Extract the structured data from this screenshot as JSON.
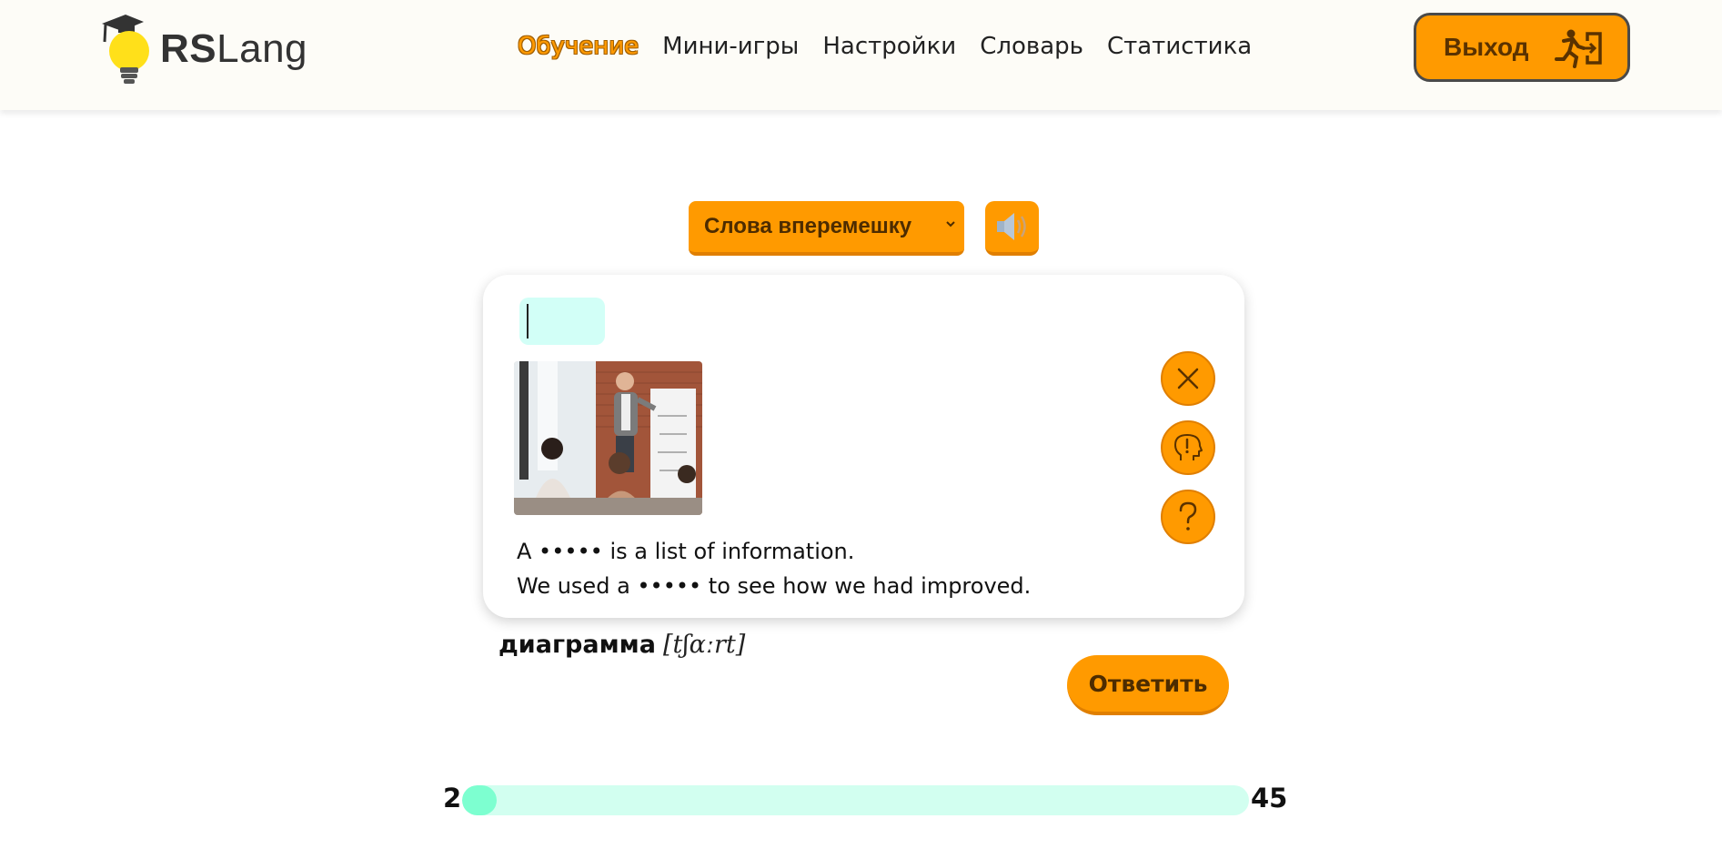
{
  "logo": {
    "brand_bold": "RS",
    "brand_light": "Lang"
  },
  "nav": {
    "items": [
      {
        "label": "Обучение",
        "active": true
      },
      {
        "label": "Мини-игры",
        "active": false
      },
      {
        "label": "Настройки",
        "active": false
      },
      {
        "label": "Словарь",
        "active": false
      },
      {
        "label": "Статистика",
        "active": false
      }
    ]
  },
  "header": {
    "logout_label": "Выход"
  },
  "controls": {
    "mode_selected": "Слова вперемешку",
    "audio_icon": "speaker-icon"
  },
  "card": {
    "answer_value": "",
    "sentences": [
      "A ••••• is a list of information.",
      "We used a ••••• to see how we had improved."
    ],
    "actions": [
      "close-icon",
      "hint-head-icon",
      "question-icon"
    ]
  },
  "translation": {
    "word": "диаграмма",
    "transcription": "[tʃɑːrt]"
  },
  "answer_button": "Ответить",
  "progress": {
    "current": "2",
    "total": "45",
    "fraction": 0.044
  },
  "colors": {
    "accent": "#ff9a00",
    "input_bg": "#d2fff7",
    "progress_track": "#d2fff0",
    "progress_fill": "#7dffd0"
  }
}
